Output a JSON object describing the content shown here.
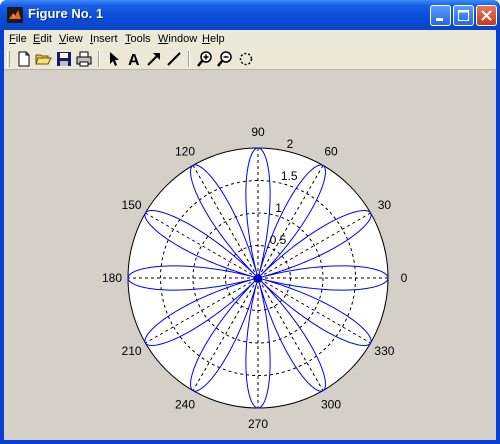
{
  "window": {
    "title": "Figure No. 1"
  },
  "menu": [
    {
      "key": "F",
      "rest": "ile"
    },
    {
      "key": "E",
      "rest": "dit"
    },
    {
      "key": "V",
      "rest": "iew"
    },
    {
      "key": "I",
      "rest": "nsert"
    },
    {
      "key": "T",
      "rest": "ools"
    },
    {
      "key": "W",
      "rest": "indow"
    },
    {
      "key": "H",
      "rest": "elp"
    }
  ],
  "toolbar": [
    "new-file-icon",
    "open-folder-icon",
    "save-icon",
    "print-icon",
    "arrow-select-icon",
    "insert-text-icon",
    "insert-arrow-icon",
    "insert-line-icon",
    "zoom-in-icon",
    "zoom-out-icon",
    "rotate-icon"
  ],
  "chart_data": {
    "type": "line",
    "subtype": "polar",
    "series": [
      {
        "expression": "r = 2·|cos(6θ)|",
        "color": "#0000ff",
        "petals": 12,
        "max_r": 2
      }
    ],
    "radial_ticks": [
      "0.5",
      "1",
      "1.5",
      "2"
    ],
    "radial_values": [
      0.5,
      1,
      1.5,
      2
    ],
    "rlim": [
      0,
      2
    ],
    "angle_labels": [
      "0",
      "30",
      "60",
      "90",
      "120",
      "150",
      "180",
      "210",
      "240",
      "270",
      "300",
      "330"
    ],
    "angle_values": [
      0,
      30,
      60,
      90,
      120,
      150,
      180,
      210,
      240,
      270,
      300,
      330
    ],
    "grid": true,
    "grid_style": "dashed"
  }
}
